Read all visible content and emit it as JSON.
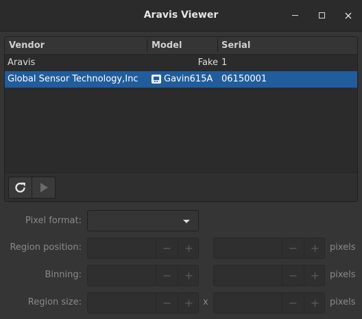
{
  "window": {
    "title": "Aravis Viewer"
  },
  "camera_list": {
    "columns": [
      "Vendor",
      "Model",
      "Serial"
    ],
    "rows": [
      {
        "vendor": "Aravis",
        "model": "Fake",
        "serial": "1",
        "has_icon": false,
        "selected": false
      },
      {
        "vendor": "Global Sensor Technology,Inc",
        "model": "Gavin615A",
        "serial": "06150001",
        "has_icon": true,
        "selected": true
      }
    ]
  },
  "toolbar": {
    "refresh_icon": "refresh-icon",
    "play_icon": "play-icon"
  },
  "form": {
    "pixel_format_label": "Pixel format:",
    "pixel_format_value": "",
    "region_position_label": "Region position:",
    "binning_label": "Binning:",
    "region_size_label": "Region size:",
    "unit": "pixels",
    "times": "x",
    "minus": "−",
    "plus": "+"
  },
  "colors": {
    "selection": "#215d9c",
    "background": "#353535"
  }
}
